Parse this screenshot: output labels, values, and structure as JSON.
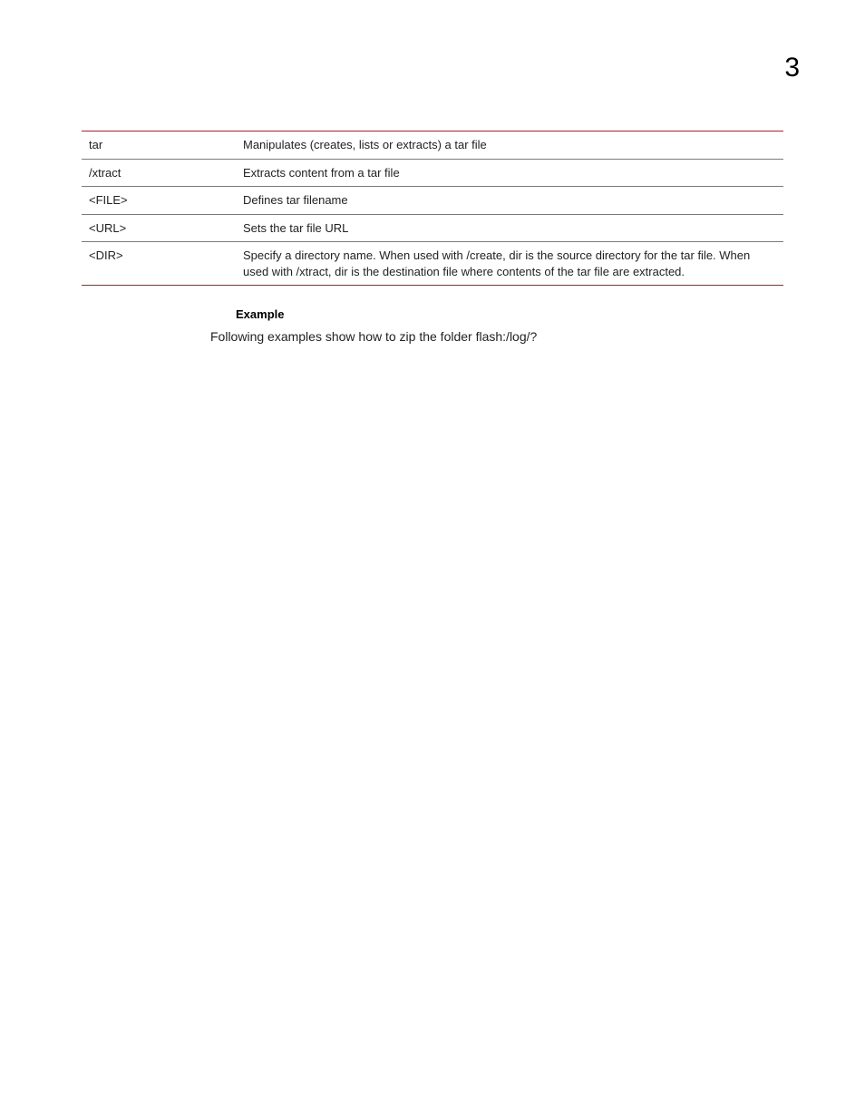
{
  "chapterNumber": "3",
  "table": {
    "rows": [
      {
        "term": "tar",
        "desc": "Manipulates (creates, lists or extracts) a tar file"
      },
      {
        "term": "/xtract",
        "desc": "Extracts content from a tar file"
      },
      {
        "term": "<FILE>",
        "desc": "Defines tar filename"
      },
      {
        "term": "<URL>",
        "desc": "Sets the tar file URL"
      },
      {
        "term": "<DIR>",
        "desc": "Specify a directory name. When used with /create, dir is the source directory for the tar file. When used with /xtract, dir is the destination file where contents of the tar file are extracted."
      }
    ]
  },
  "sectionHeading": "Example",
  "bodyText": "Following examples show how to zip the folder flash:/log/?"
}
